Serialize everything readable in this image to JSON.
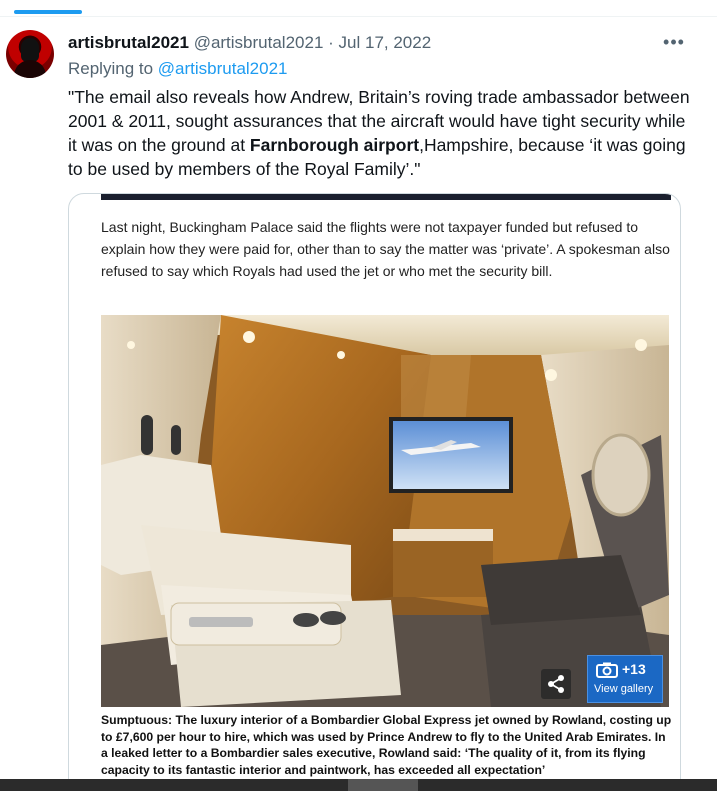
{
  "tweet": {
    "author_name": "artisbrutal2021",
    "handle": "@artisbrutal2021",
    "separator": "·",
    "date": "Jul 17, 2022",
    "replying_prefix": "Replying to ",
    "replying_to": "@artisbrutal2021",
    "text_part1": "\"The email also reveals how Andrew, Britain’s roving trade ambassador between 2001 & 2011, sought assurances that the aircraft would have tight security while it was on the ground at ",
    "text_bold": "Farnborough airport",
    "text_part2": ",Hampshire, because ‘it was going to be used by members of the Royal Family’.\"",
    "more_icon": "ellipsis-icon"
  },
  "card": {
    "paragraph": "Last night, Buckingham Palace said the flights were not taxpayer funded but refused to explain how they were paid for, other than to say the matter was ‘private’. A spokesman also refused to say which Royals had used the jet or who met the security bill.",
    "gallery_count": "+13",
    "gallery_label": "View gallery",
    "caption": "Sumptuous: The luxury interior of a Bombardier Global Express jet owned by Rowland, costing up to £7,600 per hour to hire, which was used by Prince Andrew to fly to the United Arab Emirates. In a leaked letter to a Bombardier sales executive, Rowland said: ‘The quality of it, from its flying capacity to its fantastic interior and paintwork, has exceeded all expectation’"
  },
  "colors": {
    "accent": "#1d9bf0",
    "secondary_text": "#536471",
    "gallery_button": "#1b68c4"
  }
}
